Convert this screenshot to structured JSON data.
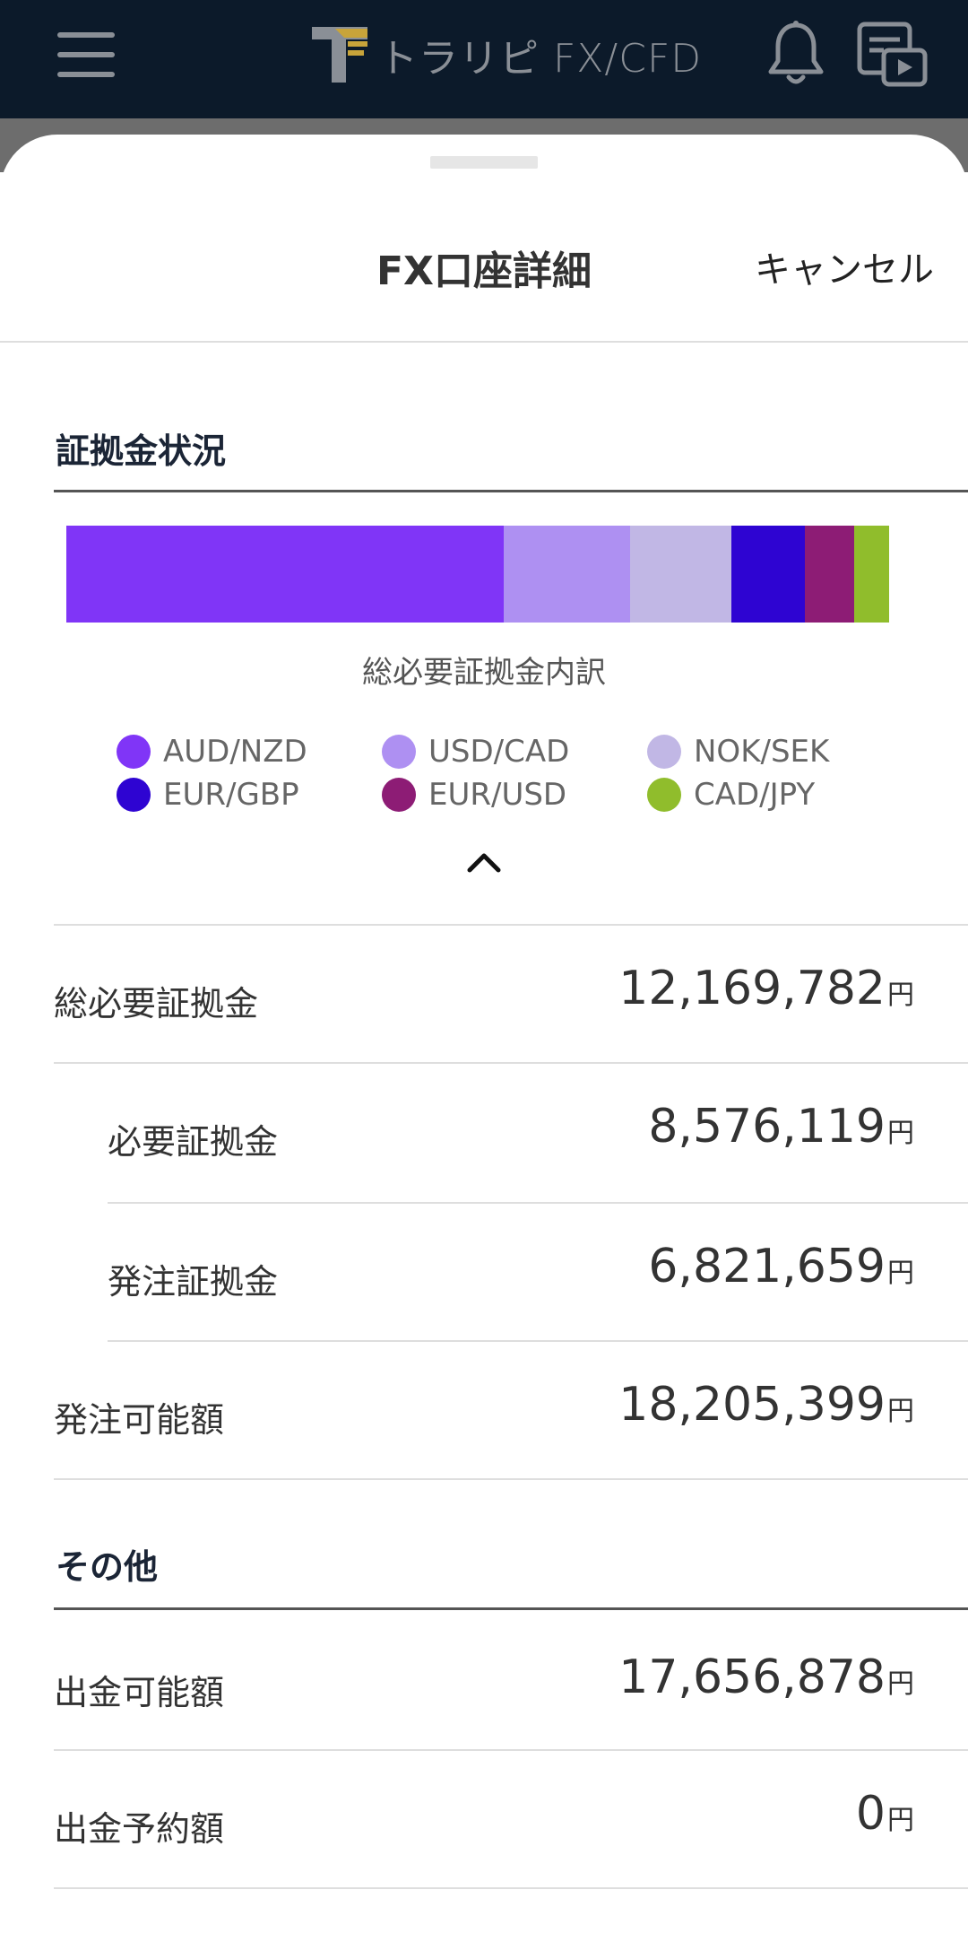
{
  "app": {
    "name": "トラリピ FX/CFD"
  },
  "sheet": {
    "title": "FX口座詳細",
    "cancel_label": "キャンセル"
  },
  "margin_section": {
    "title": "証拠金状況",
    "chart_label": "総必要証拠金内訳",
    "chart_data": {
      "type": "bar",
      "orientation": "stacked-horizontal",
      "title": "総必要証拠金内訳",
      "series": [
        {
          "name": "AUD/NZD",
          "share": 0.532,
          "color": "#8035f7"
        },
        {
          "name": "USD/CAD",
          "share": 0.153,
          "color": "#ae90f2"
        },
        {
          "name": "NOK/SEK",
          "share": 0.123,
          "color": "#c1b7e5"
        },
        {
          "name": "EUR/GBP",
          "share": 0.09,
          "color": "#2e04d2"
        },
        {
          "name": "EUR/USD",
          "share": 0.059,
          "color": "#8d1c75"
        },
        {
          "name": "CAD/JPY",
          "share": 0.043,
          "color": "#90bd2c"
        }
      ],
      "legend_placement": "bottom"
    },
    "rows": [
      {
        "label": "総必要証拠金",
        "value": "12,169,782",
        "unit": "円"
      },
      {
        "label": "必要証拠金",
        "value": "8,576,119",
        "unit": "円"
      },
      {
        "label": "発注証拠金",
        "value": "6,821,659",
        "unit": "円"
      },
      {
        "label": "発注可能額",
        "value": "18,205,399",
        "unit": "円"
      }
    ]
  },
  "other_section": {
    "title": "その他",
    "rows": [
      {
        "label": "出金可能額",
        "value": "17,656,878",
        "unit": "円"
      },
      {
        "label": "出金予約額",
        "value": "0",
        "unit": "円"
      }
    ]
  },
  "icons": {
    "menu": "hamburger-menu-icon",
    "bell": "bell-icon",
    "video": "video-icon",
    "collapse": "chevron-up-icon"
  }
}
